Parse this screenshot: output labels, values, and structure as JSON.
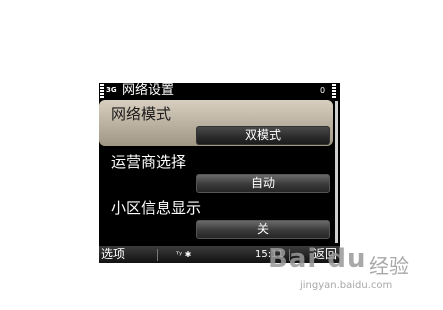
{
  "status_bar": {
    "network_badge": "3G",
    "title": "网络设置",
    "battery_level": "0"
  },
  "settings": [
    {
      "label": "网络模式",
      "value": "双模式",
      "selected": true
    },
    {
      "label": "运营商选择",
      "value": "自动",
      "selected": false
    },
    {
      "label": "小区信息显示",
      "value": "关",
      "selected": false
    }
  ],
  "softkeys": {
    "left": "选项",
    "indicators": "ᵀʸ ✱",
    "time": "15:11",
    "right": "返回"
  },
  "watermark": {
    "logo": "Bai du",
    "text": "经验",
    "url": "jingyan.baidu.com"
  },
  "colors": {
    "screen_background": "#000000",
    "selection_highlight": "#c8bfae"
  },
  "icons": [
    "signal-strength-icon",
    "battery-icon"
  ]
}
